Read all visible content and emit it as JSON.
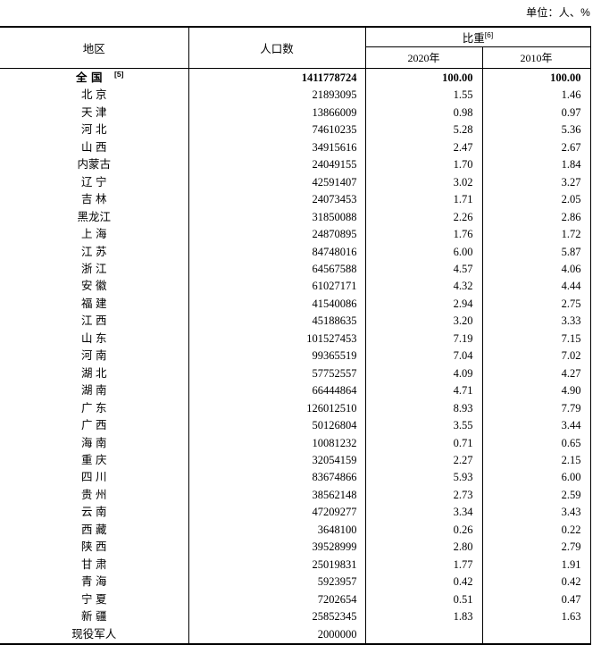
{
  "unit_note": "单位：人、%",
  "table": {
    "headers": {
      "region": "地区",
      "population": "人口数",
      "ratio": "比重",
      "ratio_footnote": "[6]",
      "year_2020": "2020年",
      "year_2010": "2010年"
    },
    "rows": [
      {
        "region": "全 国",
        "footnote": "[5]",
        "population": "1411778724",
        "pct2020": "100.00",
        "pct2010": "100.00",
        "bold": true
      },
      {
        "region": "北 京",
        "footnote": "",
        "population": "21893095",
        "pct2020": "1.55",
        "pct2010": "1.46",
        "bold": false
      },
      {
        "region": "天 津",
        "footnote": "",
        "population": "13866009",
        "pct2020": "0.98",
        "pct2010": "0.97",
        "bold": false
      },
      {
        "region": "河 北",
        "footnote": "",
        "population": "74610235",
        "pct2020": "5.28",
        "pct2010": "5.36",
        "bold": false
      },
      {
        "region": "山 西",
        "footnote": "",
        "population": "34915616",
        "pct2020": "2.47",
        "pct2010": "2.67",
        "bold": false
      },
      {
        "region": "内蒙古",
        "footnote": "",
        "population": "24049155",
        "pct2020": "1.70",
        "pct2010": "1.84",
        "bold": false
      },
      {
        "region": "辽 宁",
        "footnote": "",
        "population": "42591407",
        "pct2020": "3.02",
        "pct2010": "3.27",
        "bold": false
      },
      {
        "region": "吉 林",
        "footnote": "",
        "population": "24073453",
        "pct2020": "1.71",
        "pct2010": "2.05",
        "bold": false
      },
      {
        "region": "黑龙江",
        "footnote": "",
        "population": "31850088",
        "pct2020": "2.26",
        "pct2010": "2.86",
        "bold": false
      },
      {
        "region": "上 海",
        "footnote": "",
        "population": "24870895",
        "pct2020": "1.76",
        "pct2010": "1.72",
        "bold": false
      },
      {
        "region": "江 苏",
        "footnote": "",
        "population": "84748016",
        "pct2020": "6.00",
        "pct2010": "5.87",
        "bold": false
      },
      {
        "region": "浙 江",
        "footnote": "",
        "population": "64567588",
        "pct2020": "4.57",
        "pct2010": "4.06",
        "bold": false
      },
      {
        "region": "安 徽",
        "footnote": "",
        "population": "61027171",
        "pct2020": "4.32",
        "pct2010": "4.44",
        "bold": false
      },
      {
        "region": "福 建",
        "footnote": "",
        "population": "41540086",
        "pct2020": "2.94",
        "pct2010": "2.75",
        "bold": false
      },
      {
        "region": "江 西",
        "footnote": "",
        "population": "45188635",
        "pct2020": "3.20",
        "pct2010": "3.33",
        "bold": false
      },
      {
        "region": "山 东",
        "footnote": "",
        "population": "101527453",
        "pct2020": "7.19",
        "pct2010": "7.15",
        "bold": false
      },
      {
        "region": "河 南",
        "footnote": "",
        "population": "99365519",
        "pct2020": "7.04",
        "pct2010": "7.02",
        "bold": false
      },
      {
        "region": "湖 北",
        "footnote": "",
        "population": "57752557",
        "pct2020": "4.09",
        "pct2010": "4.27",
        "bold": false
      },
      {
        "region": "湖 南",
        "footnote": "",
        "population": "66444864",
        "pct2020": "4.71",
        "pct2010": "4.90",
        "bold": false
      },
      {
        "region": "广 东",
        "footnote": "",
        "population": "126012510",
        "pct2020": "8.93",
        "pct2010": "7.79",
        "bold": false
      },
      {
        "region": "广 西",
        "footnote": "",
        "population": "50126804",
        "pct2020": "3.55",
        "pct2010": "3.44",
        "bold": false
      },
      {
        "region": "海 南",
        "footnote": "",
        "population": "10081232",
        "pct2020": "0.71",
        "pct2010": "0.65",
        "bold": false
      },
      {
        "region": "重 庆",
        "footnote": "",
        "population": "32054159",
        "pct2020": "2.27",
        "pct2010": "2.15",
        "bold": false
      },
      {
        "region": "四 川",
        "footnote": "",
        "population": "83674866",
        "pct2020": "5.93",
        "pct2010": "6.00",
        "bold": false
      },
      {
        "region": "贵 州",
        "footnote": "",
        "population": "38562148",
        "pct2020": "2.73",
        "pct2010": "2.59",
        "bold": false
      },
      {
        "region": "云 南",
        "footnote": "",
        "population": "47209277",
        "pct2020": "3.34",
        "pct2010": "3.43",
        "bold": false
      },
      {
        "region": "西 藏",
        "footnote": "",
        "population": "3648100",
        "pct2020": "0.26",
        "pct2010": "0.22",
        "bold": false
      },
      {
        "region": "陕 西",
        "footnote": "",
        "population": "39528999",
        "pct2020": "2.80",
        "pct2010": "2.79",
        "bold": false
      },
      {
        "region": "甘 肃",
        "footnote": "",
        "population": "25019831",
        "pct2020": "1.77",
        "pct2010": "1.91",
        "bold": false
      },
      {
        "region": "青 海",
        "footnote": "",
        "population": "5923957",
        "pct2020": "0.42",
        "pct2010": "0.42",
        "bold": false
      },
      {
        "region": "宁 夏",
        "footnote": "",
        "population": "7202654",
        "pct2020": "0.51",
        "pct2010": "0.47",
        "bold": false
      },
      {
        "region": "新 疆",
        "footnote": "",
        "population": "25852345",
        "pct2020": "1.83",
        "pct2010": "1.63",
        "bold": false
      },
      {
        "region": "现役军人",
        "footnote": "",
        "population": "2000000",
        "pct2020": "",
        "pct2010": "",
        "bold": false
      }
    ]
  }
}
